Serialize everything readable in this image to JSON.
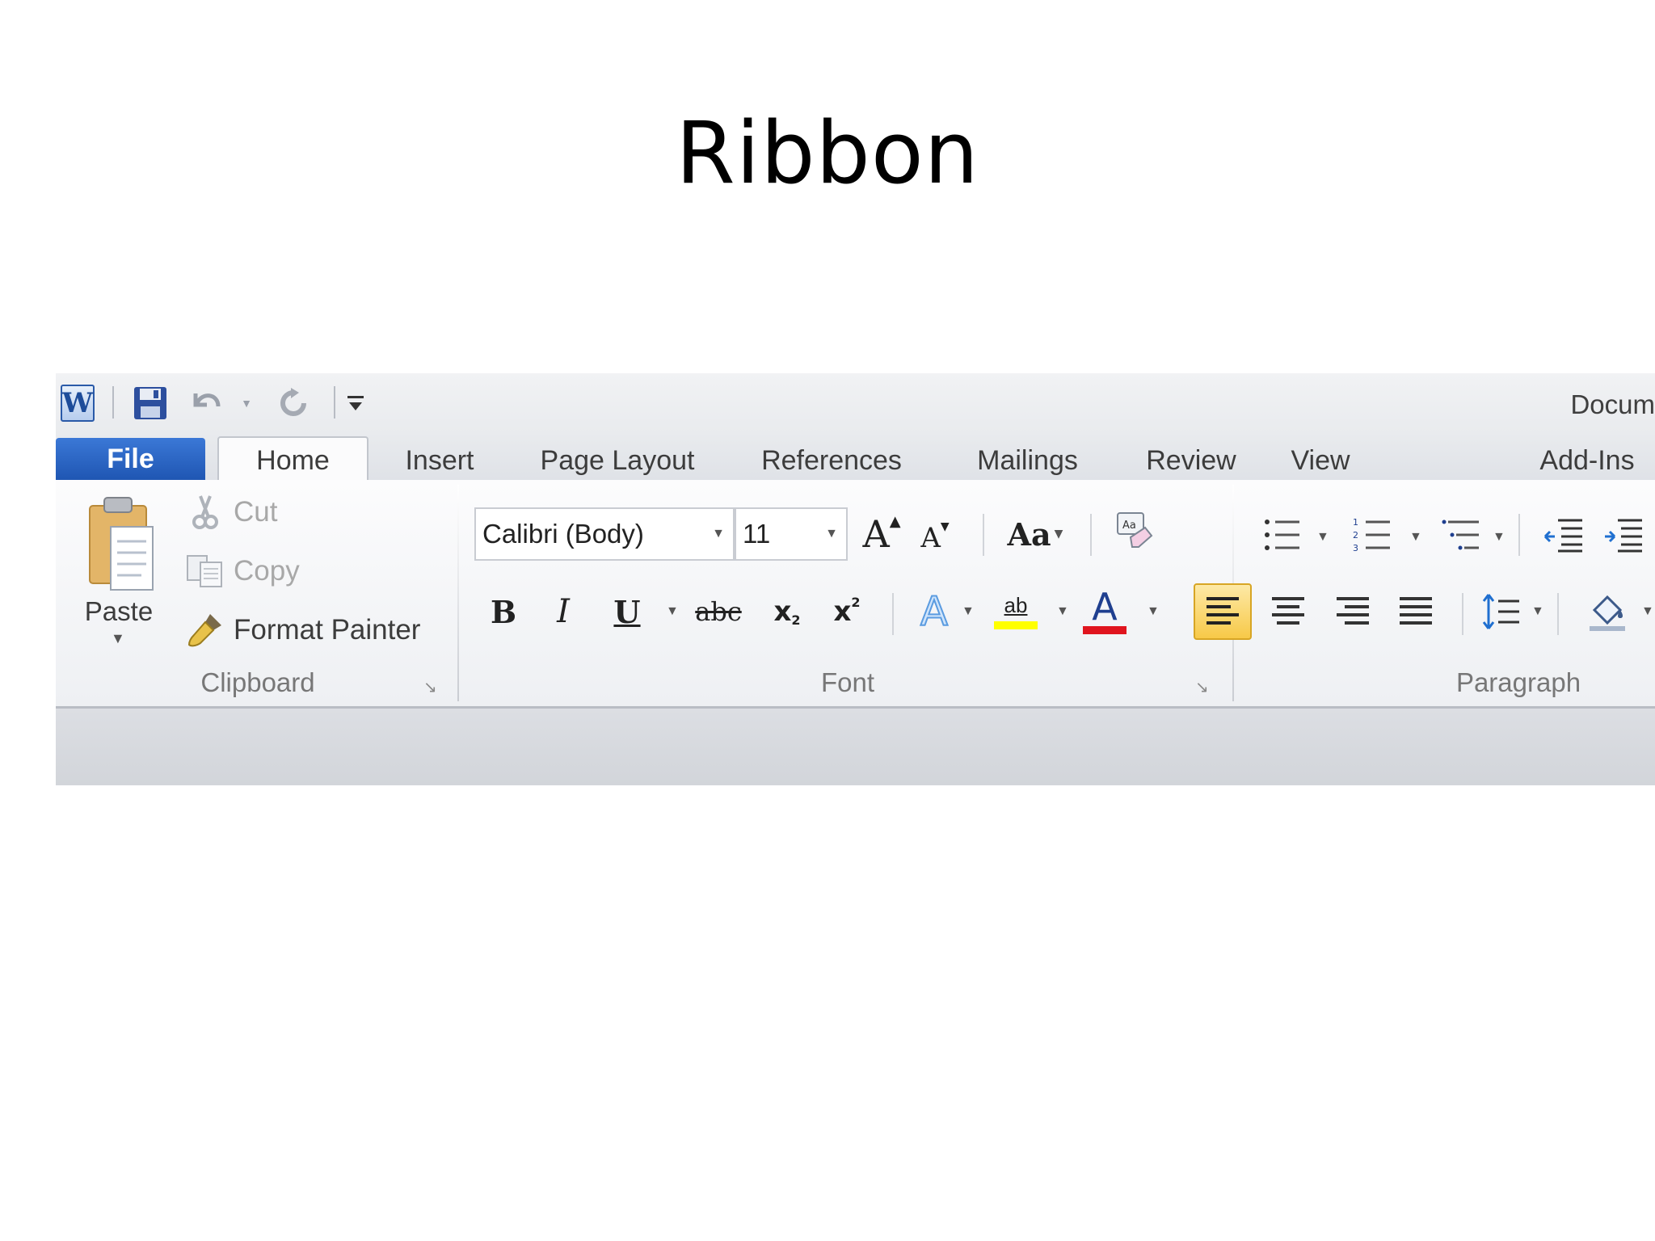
{
  "slide": {
    "title": "Ribbon"
  },
  "window": {
    "doc_title": "Docum"
  },
  "tabs": [
    {
      "label": "File"
    },
    {
      "label": "Home"
    },
    {
      "label": "Insert"
    },
    {
      "label": "Page Layout"
    },
    {
      "label": "References"
    },
    {
      "label": "Mailings"
    },
    {
      "label": "Review"
    },
    {
      "label": "View"
    },
    {
      "label": "Add-Ins"
    }
  ],
  "clipboard": {
    "paste": "Paste",
    "cut": "Cut",
    "copy": "Copy",
    "format_painter": "Format Painter",
    "group_label": "Clipboard"
  },
  "font": {
    "font_name": "Calibri (Body)",
    "font_size": "11",
    "group_label": "Font",
    "highlight_color": "#ffff00",
    "font_color": "#e0141e"
  },
  "paragraph": {
    "group_label": "Paragraph",
    "active_alignment": "align-left"
  }
}
